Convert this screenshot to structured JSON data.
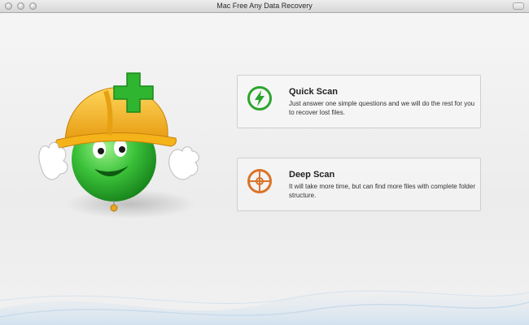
{
  "window": {
    "title": "Mac Free Any Data Recovery"
  },
  "options": {
    "quick_scan": {
      "title": "Quick Scan",
      "description": "Just answer one simple questions and we will do the rest for you to recover lost files.",
      "icon": "lightning-icon",
      "color": "#2ca52e"
    },
    "deep_scan": {
      "title": "Deep Scan",
      "description": "It will take more time, but can find more files with complete folder structure.",
      "icon": "crosshair-icon",
      "color": "#d9742a"
    }
  },
  "mascot": {
    "icon": "mascot-icon",
    "helmet_color": "#f5b31a",
    "body_color": "#3cc23a",
    "plus_color": "#2fb52f"
  }
}
